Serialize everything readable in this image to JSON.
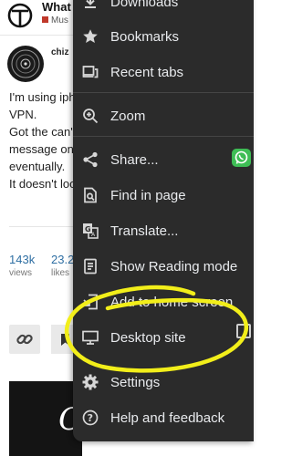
{
  "colors": {
    "menu_bg": "#2b2b2b",
    "menu_text": "#e8eaed",
    "highlight_yellow": "#f2ee1a",
    "link_blue": "#2f6fa3",
    "category_red": "#c0392b",
    "whatsapp_green": "#3ebd55"
  },
  "site": {
    "title": "What",
    "category": "Mus",
    "author": "chiz",
    "post_lines": [
      "I'm using iph",
      "VPN.",
      "Got the can't",
      "message on",
      "eventually.",
      "It doesn't loo"
    ],
    "stats": [
      {
        "value": "143k",
        "label": "views"
      },
      {
        "value": "23.2",
        "label": "likes"
      }
    ],
    "banner_letter": "C"
  },
  "menu": {
    "items": [
      {
        "label": "Downloads",
        "icon": "download-icon"
      },
      {
        "label": "Bookmarks",
        "icon": "star-icon"
      },
      {
        "label": "Recent tabs",
        "icon": "recent-tabs-icon"
      },
      {
        "label": "Zoom",
        "icon": "zoom-in-icon"
      },
      {
        "label": "Share...",
        "icon": "share-icon"
      },
      {
        "label": "Find in page",
        "icon": "find-in-page-icon"
      },
      {
        "label": "Translate...",
        "icon": "translate-icon"
      },
      {
        "label": "Show Reading mode",
        "icon": "reading-mode-icon"
      },
      {
        "label": "Add to home screen",
        "icon": "add-to-home-icon"
      },
      {
        "label": "Desktop site",
        "icon": "desktop-icon",
        "checked": false
      },
      {
        "label": "Settings",
        "icon": "gear-icon"
      },
      {
        "label": "Help and feedback",
        "icon": "help-icon"
      }
    ]
  }
}
